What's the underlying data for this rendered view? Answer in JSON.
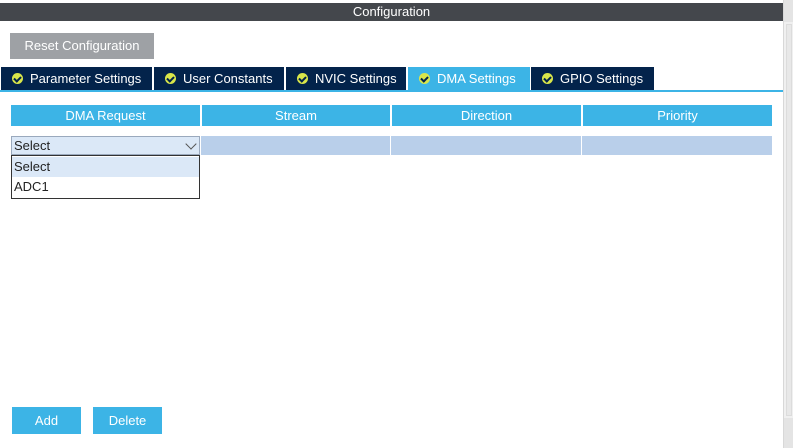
{
  "header": {
    "title": "Configuration"
  },
  "toolbar": {
    "reset_label": "Reset Configuration"
  },
  "tabs": [
    {
      "label": "Parameter Settings",
      "active": false
    },
    {
      "label": "User Constants",
      "active": false
    },
    {
      "label": "NVIC Settings",
      "active": false
    },
    {
      "label": "DMA Settings",
      "active": true
    },
    {
      "label": "GPIO Settings",
      "active": false
    }
  ],
  "table": {
    "columns": [
      "DMA Request",
      "Stream",
      "Direction",
      "Priority"
    ]
  },
  "dma_request_select": {
    "value": "Select",
    "options": [
      "Select",
      "ADC1"
    ]
  },
  "actions": {
    "add_label": "Add",
    "delete_label": "Delete"
  },
  "colors": {
    "accent": "#3cb4e6",
    "tab_dark": "#03234b",
    "title_bar": "#44474c",
    "row_fill": "#b9cfea",
    "status_ok": "#d9e64a"
  }
}
